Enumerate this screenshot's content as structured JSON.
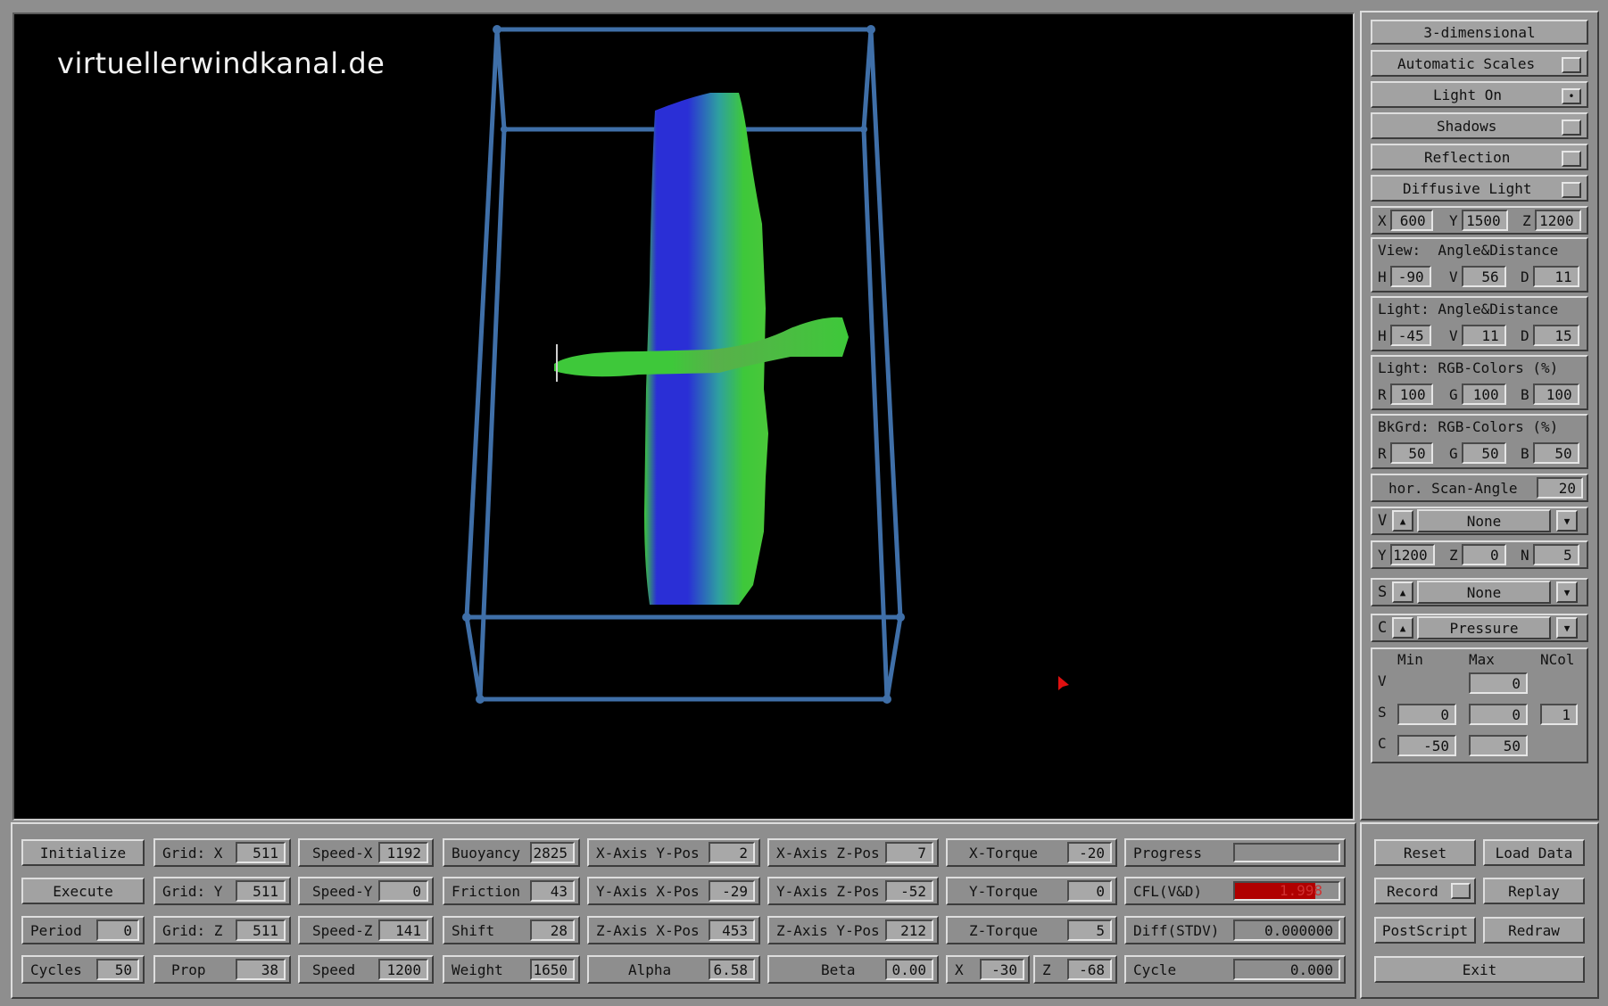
{
  "viewport": {
    "watermark": "virtuellerwindkanal.de"
  },
  "colors": {
    "bbox": "#3f6fa8",
    "model_blue": "#2a2fd6",
    "model_green": "#3ec83a",
    "cursor": "#e01010",
    "cfl_bar": "#b00000"
  },
  "right_panel": {
    "toggles": [
      {
        "label": "3-dimensional",
        "checked": null
      },
      {
        "label": "Automatic Scales",
        "checked": false
      },
      {
        "label": "Light On",
        "checked": true
      },
      {
        "label": "Shadows",
        "checked": false
      },
      {
        "label": "Reflection",
        "checked": false
      },
      {
        "label": "Diffusive Light",
        "checked": false
      }
    ],
    "position": {
      "x_label": "X",
      "x": "600",
      "y_label": "Y",
      "y": "1500",
      "z_label": "Z",
      "z": "1200"
    },
    "view": {
      "title": "View:  Angle&Distance",
      "h_label": "H",
      "h": "-90",
      "v_label": "V",
      "v": "56",
      "d_label": "D",
      "d": "11"
    },
    "light": {
      "title": "Light: Angle&Distance",
      "h_label": "H",
      "h": "-45",
      "v_label": "V",
      "v": "11",
      "d_label": "D",
      "d": "15"
    },
    "light_rgb": {
      "title": "Light: RGB-Colors (%)",
      "r_label": "R",
      "r": "100",
      "g_label": "G",
      "g": "100",
      "b_label": "B",
      "b": "100"
    },
    "bkgrd_rgb": {
      "title": "BkGrd: RGB-Colors (%)",
      "r_label": "R",
      "r": "50",
      "g_label": "G",
      "g": "50",
      "b_label": "B",
      "b": "50"
    },
    "scan": {
      "label": "hor. Scan-Angle",
      "value": "20"
    },
    "v_select": {
      "letter": "V",
      "value": "None"
    },
    "yzn": {
      "y_label": "Y",
      "y": "1200",
      "z_label": "Z",
      "z": "0",
      "n_label": "N",
      "n": "5"
    },
    "s_select": {
      "letter": "S",
      "value": "None"
    },
    "c_select": {
      "letter": "C",
      "value": "Pressure"
    },
    "scales": {
      "min_label": "Min",
      "max_label": "Max",
      "ncol_label": "NCol",
      "v_label": "V",
      "v_max": "0",
      "s_label": "S",
      "s_min": "0",
      "s_max": "0",
      "s_ncol": "1",
      "c_label": "C",
      "c_min": "-50",
      "c_max": "50"
    }
  },
  "bottom": {
    "initialize": "Initialize",
    "execute": "Execute",
    "period": {
      "label": "Period",
      "value": "0"
    },
    "cycles": {
      "label": "Cycles",
      "value": "50"
    },
    "grid_x": {
      "label": "Grid: X",
      "value": "511"
    },
    "grid_y": {
      "label": "Grid: Y",
      "value": "511"
    },
    "grid_z": {
      "label": "Grid: Z",
      "value": "511"
    },
    "prop": {
      "label": "Prop",
      "value": "38"
    },
    "speed_x": {
      "label": "Speed-X",
      "value": "1192"
    },
    "speed_y": {
      "label": "Speed-Y",
      "value": "0"
    },
    "speed_z": {
      "label": "Speed-Z",
      "value": "141"
    },
    "speed": {
      "label": "Speed",
      "value": "1200"
    },
    "buoyancy": {
      "label": "Buoyancy",
      "value": "2825"
    },
    "friction": {
      "label": "Friction",
      "value": "43"
    },
    "shift": {
      "label": "Shift",
      "value": "28"
    },
    "weight": {
      "label": "Weight",
      "value": "1650"
    },
    "xaxis_ypos": {
      "label": "X-Axis Y-Pos",
      "value": "2"
    },
    "yaxis_xpos": {
      "label": "Y-Axis X-Pos",
      "value": "-29"
    },
    "zaxis_xpos": {
      "label": "Z-Axis X-Pos",
      "value": "453"
    },
    "alpha": {
      "label": "Alpha",
      "value": "6.58"
    },
    "xaxis_zpos": {
      "label": "X-Axis Z-Pos",
      "value": "7"
    },
    "yaxis_zpos": {
      "label": "Y-Axis Z-Pos",
      "value": "-52"
    },
    "zaxis_ypos": {
      "label": "Z-Axis Y-Pos",
      "value": "212"
    },
    "beta": {
      "label": "Beta",
      "value": "0.00"
    },
    "x_torque": {
      "label": "X-Torque",
      "value": "-20"
    },
    "y_torque": {
      "label": "Y-Torque",
      "value": "0"
    },
    "z_torque": {
      "label": "Z-Torque",
      "value": "5"
    },
    "x_small": {
      "label": "X",
      "value": "-30"
    },
    "z_small": {
      "label": "Z",
      "value": "-68"
    },
    "progress": {
      "label": "Progress",
      "fraction": 0.0
    },
    "cfl": {
      "label": "CFL(V&D)",
      "value": "1.998"
    },
    "diff": {
      "label": "Diff(STDV)",
      "value": "0.000000"
    },
    "cycle": {
      "label": "Cycle",
      "value": "0.000"
    },
    "reset": "Reset",
    "load_data": "Load Data",
    "record": "Record",
    "replay": "Replay",
    "postscript": "PostScript",
    "redraw": "Redraw",
    "exit": "Exit"
  }
}
